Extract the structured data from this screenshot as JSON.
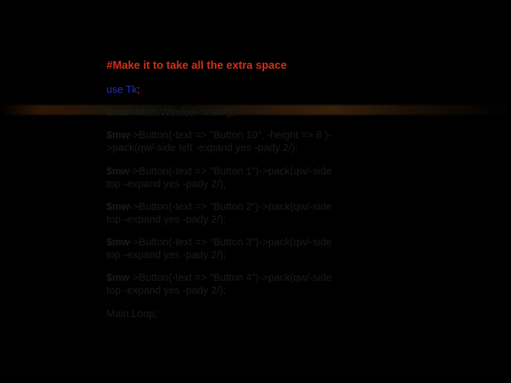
{
  "title": "#Make it to take all the extra space",
  "use_line": {
    "use": " use ",
    "tk": "Tk",
    "semi": ";"
  },
  "mw_new": {
    "var": "$mw",
    "rest": "=Main.Window->new();"
  },
  "btn10": {
    "var": " $mw",
    "rest": "->Button(-text => \"Button 10\", -height => 8 )->pack(qw/-side left -expand yes -pady 2/);"
  },
  "btn1": {
    "var": "$mw",
    "rest": "->Button(-text => \"Button 1\")->pack(qw/-side top -expand yes -pady 2/);"
  },
  "btn2": {
    "var": "$mw",
    "rest": "->Button(-text => \"Button 2\")->pack(qw/-side top -expand yes -pady 2/);"
  },
  "btn3": {
    "var": "$mw",
    "rest": "->Button(-text => \"Button 3\")->pack(qw/-side top -expand yes -pady 2/);"
  },
  "btn4": {
    "var": "$mw",
    "rest": "->Button(-text => \"Button 4\")->pack(qw/-side top -expand yes -pady 2/);"
  },
  "mainloop": "Main.Loop;"
}
